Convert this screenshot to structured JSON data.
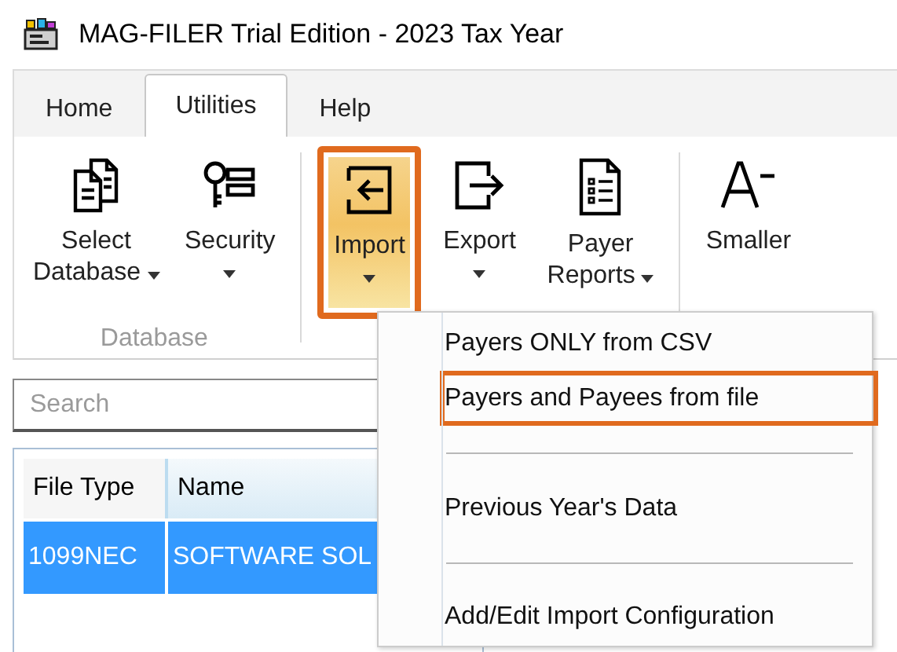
{
  "window": {
    "title": "MAG-FILER Trial Edition - 2023 Tax Year"
  },
  "tabs": [
    {
      "label": "Home",
      "selected": false
    },
    {
      "label": "Utilities",
      "selected": true
    },
    {
      "label": "Help",
      "selected": false
    }
  ],
  "ribbon": {
    "groups": [
      {
        "label": "Database",
        "buttons": [
          {
            "label": [
              "Select",
              "Database"
            ],
            "dropdown": true,
            "pressed": false,
            "highlighted": false
          },
          {
            "label": [
              "Security"
            ],
            "dropdown": true,
            "pressed": false,
            "highlighted": false
          }
        ]
      },
      {
        "buttons": [
          {
            "label": [
              "Import"
            ],
            "dropdown": true,
            "pressed": true,
            "highlighted": true
          },
          {
            "label": [
              "Export"
            ],
            "dropdown": true,
            "pressed": false,
            "highlighted": false
          },
          {
            "label": [
              "Payer",
              "Reports"
            ],
            "dropdown": true,
            "pressed": false,
            "highlighted": false
          }
        ]
      },
      {
        "buttons": [
          {
            "label": [
              "Smaller"
            ],
            "dropdown": false,
            "pressed": false,
            "highlighted": false
          }
        ]
      }
    ]
  },
  "search": {
    "placeholder": "Search"
  },
  "table": {
    "columns": [
      "File Type",
      "Name"
    ],
    "rows": [
      {
        "cells": [
          "1099NEC",
          "SOFTWARE SOL"
        ],
        "selected": true
      }
    ]
  },
  "import_menu": {
    "items": [
      {
        "kind": "item",
        "label": "Payers ONLY from CSV",
        "highlighted": false
      },
      {
        "kind": "item",
        "label": "Payers and Payees from file",
        "highlighted": true
      },
      {
        "kind": "separator"
      },
      {
        "kind": "item",
        "label": "Previous Year's Data",
        "highlighted": false
      },
      {
        "kind": "separator"
      },
      {
        "kind": "item",
        "label": "Add/Edit Import Configuration",
        "highlighted": false
      }
    ]
  }
}
